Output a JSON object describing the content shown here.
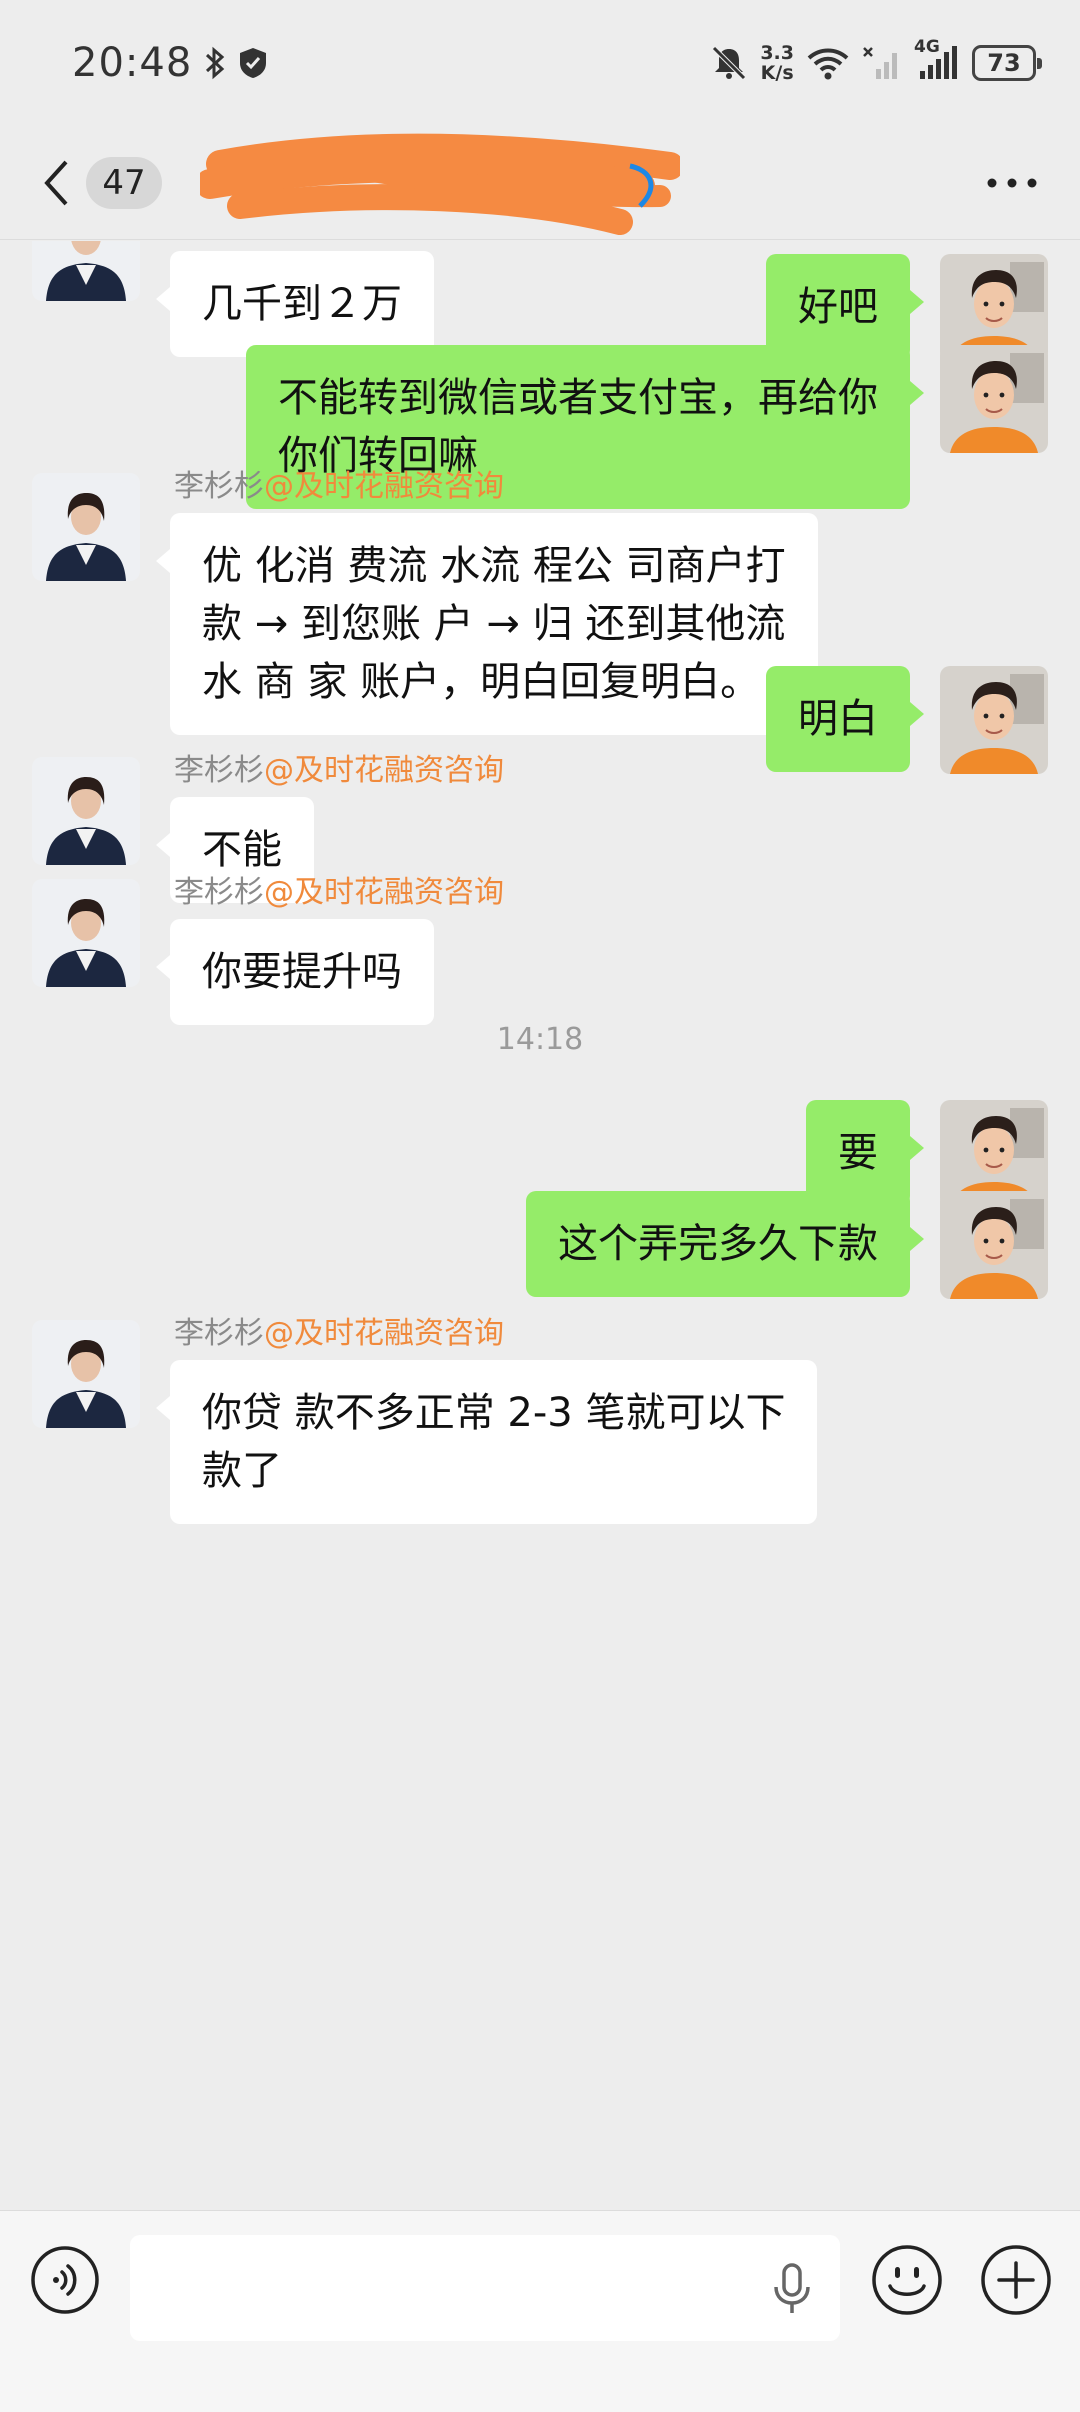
{
  "status_bar": {
    "time": "20:48",
    "net_speed_value": "3.3",
    "net_speed_unit": "K/s",
    "network_type": "4G",
    "battery": "73",
    "icons": [
      "bluetooth-icon",
      "shield-icon",
      "mute-bell-icon",
      "wifi-icon",
      "signal-x-icon",
      "signal-4g-icon",
      "battery-icon"
    ]
  },
  "header": {
    "unread_count": "47",
    "title_note": "",
    "scribble_color": "#f58a42"
  },
  "contacts": {
    "agent_name": "李杉杉",
    "agent_org": "@及时花融资咨询"
  },
  "messages": [
    {
      "dir": "in",
      "text": "几千到２万",
      "show_name": false
    },
    {
      "dir": "out",
      "text": "好吧"
    },
    {
      "dir": "out",
      "line1": "不能转到微信或者支付宝，再给你",
      "line2": "你们转回嘛"
    },
    {
      "dir": "in",
      "show_name": true,
      "line1": "优 化消 费流 水流 程公 司商户打",
      "line2": "款 → 到您账 户 → 归 还到其他流",
      "line3": "水 商 家 账户，明白回复明白。"
    },
    {
      "dir": "out",
      "text": "明白"
    },
    {
      "dir": "in",
      "show_name": true,
      "text": "不能"
    },
    {
      "dir": "in",
      "show_name": true,
      "text": "你要提升吗"
    },
    {
      "type": "time",
      "text": "14:18"
    },
    {
      "dir": "out",
      "text": "要"
    },
    {
      "dir": "out",
      "text": "这个弄完多久下款"
    },
    {
      "dir": "in",
      "show_name": true,
      "line1": "你贷 款不多正常 2-3 笔就可以下",
      "line2": "款了"
    }
  ],
  "input_bar": {
    "placeholder": "",
    "value": ""
  },
  "colors": {
    "background": "#ededed",
    "outgoing_bubble": "#95ec69",
    "incoming_bubble": "#ffffff",
    "org_tag": "#f08a3c"
  }
}
